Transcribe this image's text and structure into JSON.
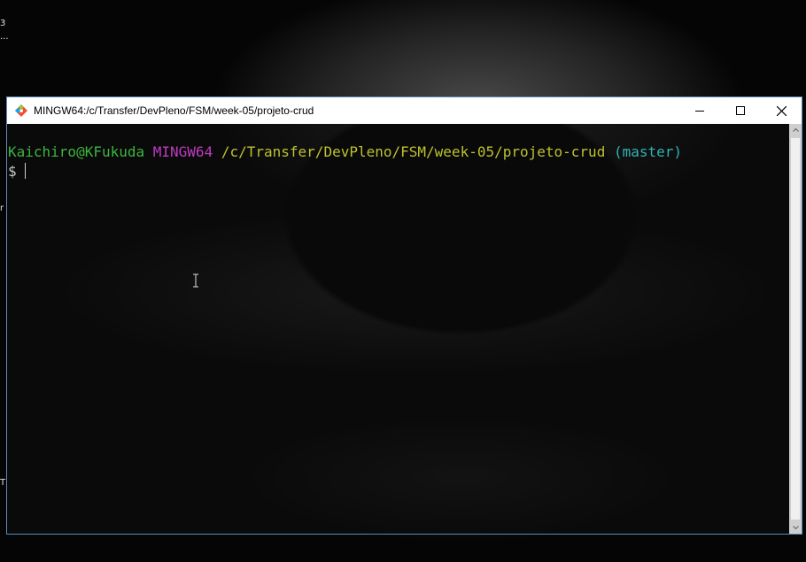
{
  "window": {
    "title": "MINGW64:/c/Transfer/DevPleno/FSM/week-05/projeto-crud",
    "app_icon": "git-bash-icon",
    "controls": [
      "minimize-icon",
      "maximize-icon",
      "close-icon"
    ]
  },
  "terminal": {
    "prompt_user": "Kaichiro@KFukuda",
    "prompt_env": "MINGW64",
    "prompt_path": "/c/Transfer/DevPleno/FSM/week-05/projeto-crud",
    "prompt_branch": "(master)",
    "prompt_symbol": "$",
    "input_value": ""
  },
  "colors": {
    "user": "#3db53d",
    "env": "#bf3abf",
    "path": "#c0c030",
    "branch": "#2fb3b3"
  },
  "desktop": {
    "glyphs": [
      "3",
      "...",
      "r",
      "T"
    ]
  }
}
